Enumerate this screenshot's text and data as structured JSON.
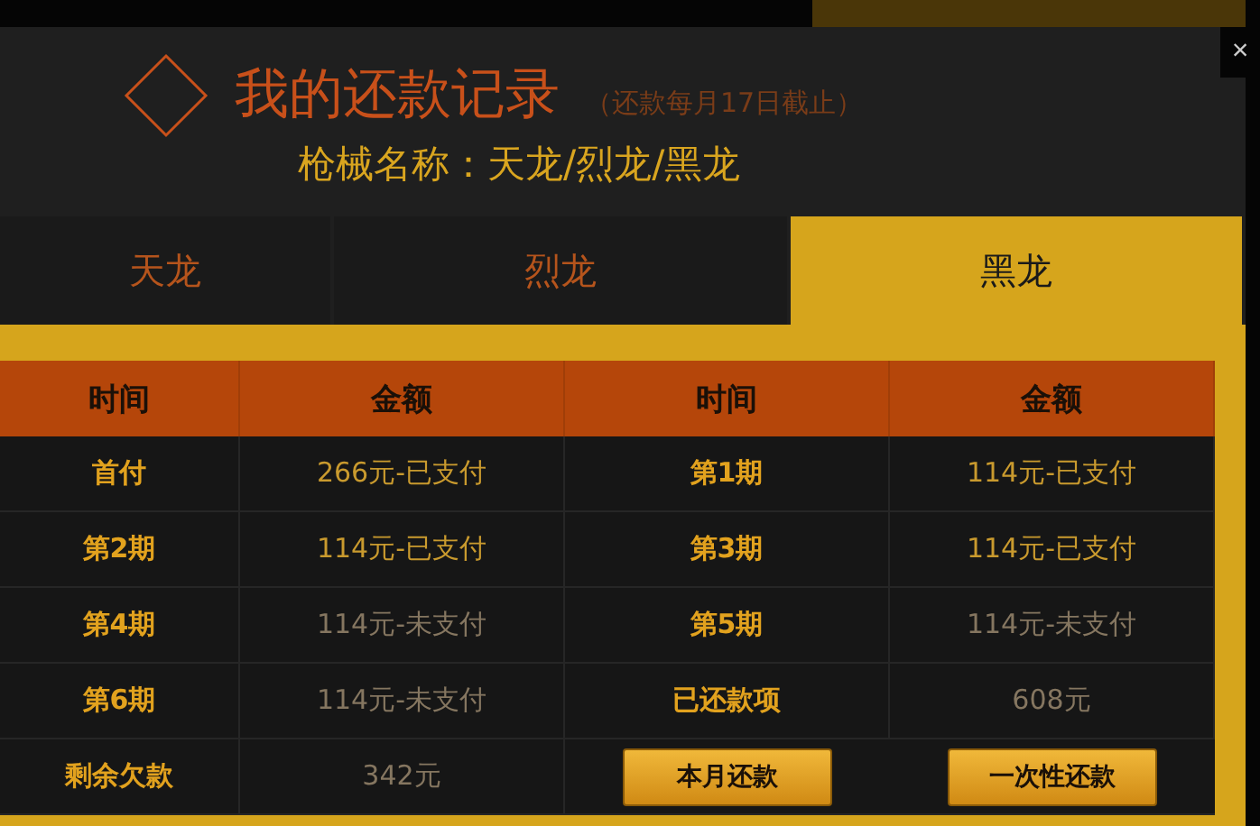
{
  "dialog": {
    "title": "我的还款记录",
    "note": "（还款每月17日截止）",
    "subtitle": "枪械名称：天龙/烈龙/黑龙",
    "close": "×"
  },
  "tabs": [
    {
      "label": "天龙",
      "selected": false
    },
    {
      "label": "烈龙",
      "selected": false
    },
    {
      "label": "黑龙",
      "selected": true
    }
  ],
  "table": {
    "columns": [
      "时间",
      "金额",
      "时间",
      "金额"
    ],
    "rows": [
      [
        {
          "text": "首付",
          "kind": "label"
        },
        {
          "text": "266元-已支付",
          "kind": "paid"
        },
        {
          "text": "第1期",
          "kind": "label"
        },
        {
          "text": "114元-已支付",
          "kind": "paid"
        }
      ],
      [
        {
          "text": "第2期",
          "kind": "label"
        },
        {
          "text": "114元-已支付",
          "kind": "paid"
        },
        {
          "text": "第3期",
          "kind": "label"
        },
        {
          "text": "114元-已支付",
          "kind": "paid"
        }
      ],
      [
        {
          "text": "第4期",
          "kind": "label"
        },
        {
          "text": "114元-未支付",
          "kind": "plain"
        },
        {
          "text": "第5期",
          "kind": "label"
        },
        {
          "text": "114元-未支付",
          "kind": "plain"
        }
      ],
      [
        {
          "text": "第6期",
          "kind": "label"
        },
        {
          "text": "114元-未支付",
          "kind": "plain"
        },
        {
          "text": "已还款项",
          "kind": "label"
        },
        {
          "text": "608元",
          "kind": "plain"
        }
      ],
      [
        {
          "text": "剩余欠款",
          "kind": "label"
        },
        {
          "text": "342元",
          "kind": "plain"
        },
        {
          "text": "本月还款",
          "kind": "button"
        },
        {
          "text": "一次性还款",
          "kind": "button"
        }
      ]
    ]
  }
}
